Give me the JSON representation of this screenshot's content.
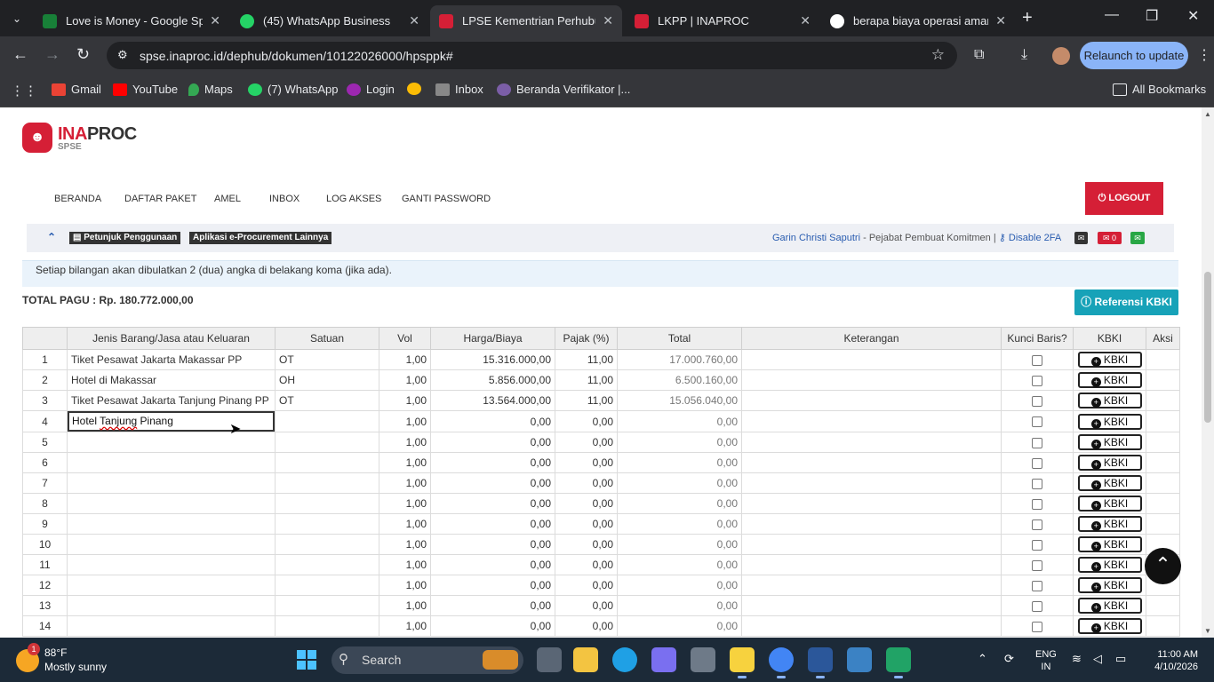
{
  "browser": {
    "tabs": [
      {
        "title": "Love is Money - Google Spre",
        "color": "#188038",
        "active": false
      },
      {
        "title": "(45) WhatsApp Business",
        "color": "#25d366",
        "active": false
      },
      {
        "title": "LPSE Kementrian Perhubung",
        "color": "#d51f36",
        "active": true
      },
      {
        "title": "LKPP | INAPROC",
        "color": "#d51f36",
        "active": false
      },
      {
        "title": "berapa biaya operasi amand",
        "color": "#ffffff",
        "active": false
      }
    ],
    "url": "spse.inaproc.id/dephub/dokumen/10122026000/hpsppk#",
    "relaunch_label": "Relaunch to update",
    "bookmarks": [
      {
        "label": "Gmail",
        "color": "#ea4335"
      },
      {
        "label": "YouTube",
        "color": "#ff0000"
      },
      {
        "label": "Maps",
        "color": "#34a853"
      },
      {
        "label": "(7) WhatsApp",
        "color": "#25d366"
      },
      {
        "label": "Login",
        "color": "#9c27b0"
      },
      {
        "label": "",
        "color": "#fbbc05"
      },
      {
        "label": "Inbox",
        "color": "#888888"
      },
      {
        "label": "Beranda Verifikator |...",
        "color": "#7b5ea7"
      }
    ],
    "all_bookmarks": "All Bookmarks"
  },
  "site": {
    "logo_main": "INA",
    "logo_bold": "PROC",
    "logo_sub": "SPSE",
    "nav": [
      "BERANDA",
      "DAFTAR PAKET",
      "AMEL",
      "INBOX",
      "LOG AKSES",
      "GANTI PASSWORD"
    ],
    "logout": "LOGOUT",
    "help_label": "Petunjuk Penggunaan",
    "apps_label": "Aplikasi e-Procurement Lainnya",
    "user_name": "Garin Christi Saputri",
    "user_role": " - Pejabat Pembuat Komitmen | ",
    "disable_2fa": "Disable 2FA",
    "mail_count": "0"
  },
  "notice": "Setiap bilangan akan dibulatkan 2 (dua) angka di belakang koma (jika ada).",
  "total_pagu": "TOTAL PAGU : Rp. 180.772.000,00",
  "ref_kbki": "Referensi KBKI",
  "table": {
    "headers": [
      "",
      "Jenis Barang/Jasa atau Keluaran",
      "Satuan",
      "Vol",
      "Harga/Biaya",
      "Pajak (%)",
      "Total",
      "Keterangan",
      "Kunci Baris?",
      "KBKI",
      "Aksi"
    ],
    "kbki_label": "KBKI",
    "rows": [
      {
        "no": "1",
        "item": "Tiket Pesawat Jakarta Makassar PP",
        "satuan": "OT",
        "vol": "1,00",
        "harga": "15.316.000,00",
        "pajak": "11,00",
        "total": "17.000.760,00"
      },
      {
        "no": "2",
        "item": "Hotel di Makassar",
        "satuan": "OH",
        "vol": "1,00",
        "harga": "5.856.000,00",
        "pajak": "11,00",
        "total": "6.500.160,00"
      },
      {
        "no": "3",
        "item": "Tiket Pesawat Jakarta Tanjung Pinang PP",
        "satuan": "OT",
        "vol": "1,00",
        "harga": "13.564.000,00",
        "pajak": "11,00",
        "total": "15.056.040,00"
      },
      {
        "no": "4",
        "item": "Hotel Tanjung Pinang",
        "satuan": "",
        "vol": "1,00",
        "harga": "0,00",
        "pajak": "0,00",
        "total": "0,00"
      },
      {
        "no": "5",
        "item": "",
        "satuan": "",
        "vol": "1,00",
        "harga": "0,00",
        "pajak": "0,00",
        "total": "0,00"
      },
      {
        "no": "6",
        "item": "",
        "satuan": "",
        "vol": "1,00",
        "harga": "0,00",
        "pajak": "0,00",
        "total": "0,00"
      },
      {
        "no": "7",
        "item": "",
        "satuan": "",
        "vol": "1,00",
        "harga": "0,00",
        "pajak": "0,00",
        "total": "0,00"
      },
      {
        "no": "8",
        "item": "",
        "satuan": "",
        "vol": "1,00",
        "harga": "0,00",
        "pajak": "0,00",
        "total": "0,00"
      },
      {
        "no": "9",
        "item": "",
        "satuan": "",
        "vol": "1,00",
        "harga": "0,00",
        "pajak": "0,00",
        "total": "0,00"
      },
      {
        "no": "10",
        "item": "",
        "satuan": "",
        "vol": "1,00",
        "harga": "0,00",
        "pajak": "0,00",
        "total": "0,00"
      },
      {
        "no": "11",
        "item": "",
        "satuan": "",
        "vol": "1,00",
        "harga": "0,00",
        "pajak": "0,00",
        "total": "0,00"
      },
      {
        "no": "12",
        "item": "",
        "satuan": "",
        "vol": "1,00",
        "harga": "0,00",
        "pajak": "0,00",
        "total": "0,00"
      },
      {
        "no": "13",
        "item": "",
        "satuan": "",
        "vol": "1,00",
        "harga": "0,00",
        "pajak": "0,00",
        "total": "0,00"
      },
      {
        "no": "14",
        "item": "",
        "satuan": "",
        "vol": "1,00",
        "harga": "0,00",
        "pajak": "0,00",
        "total": "0,00"
      }
    ],
    "editing_row": "4",
    "editing_value_a": "Hotel ",
    "editing_value_b": "Tanjung",
    "editing_value_c": " Pinang"
  },
  "taskbar": {
    "weather_temp": "88°F",
    "weather_desc": "Mostly sunny",
    "weather_badge": "1",
    "search_label": "Search",
    "lang_1": "ENG",
    "lang_2": "IN",
    "time": "11:00 AM",
    "date": "4/10/2026",
    "apps": [
      {
        "name": "file-explorer",
        "color": "#f3c441"
      },
      {
        "name": "edge",
        "color": "#1fa0e5"
      },
      {
        "name": "copilot",
        "color": "#7a6ff0"
      },
      {
        "name": "camera",
        "color": "#6e7a88"
      },
      {
        "name": "sticky-notes",
        "color": "#f7d23e"
      },
      {
        "name": "chrome",
        "color": "#4285f4"
      },
      {
        "name": "word",
        "color": "#2b579a"
      },
      {
        "name": "calculator",
        "color": "#3b82c4"
      },
      {
        "name": "excel",
        "color": "#21a366"
      }
    ]
  },
  "colors": {
    "brand": "#d51f36",
    "teal": "#17a2b8",
    "link": "#2a5db0"
  }
}
